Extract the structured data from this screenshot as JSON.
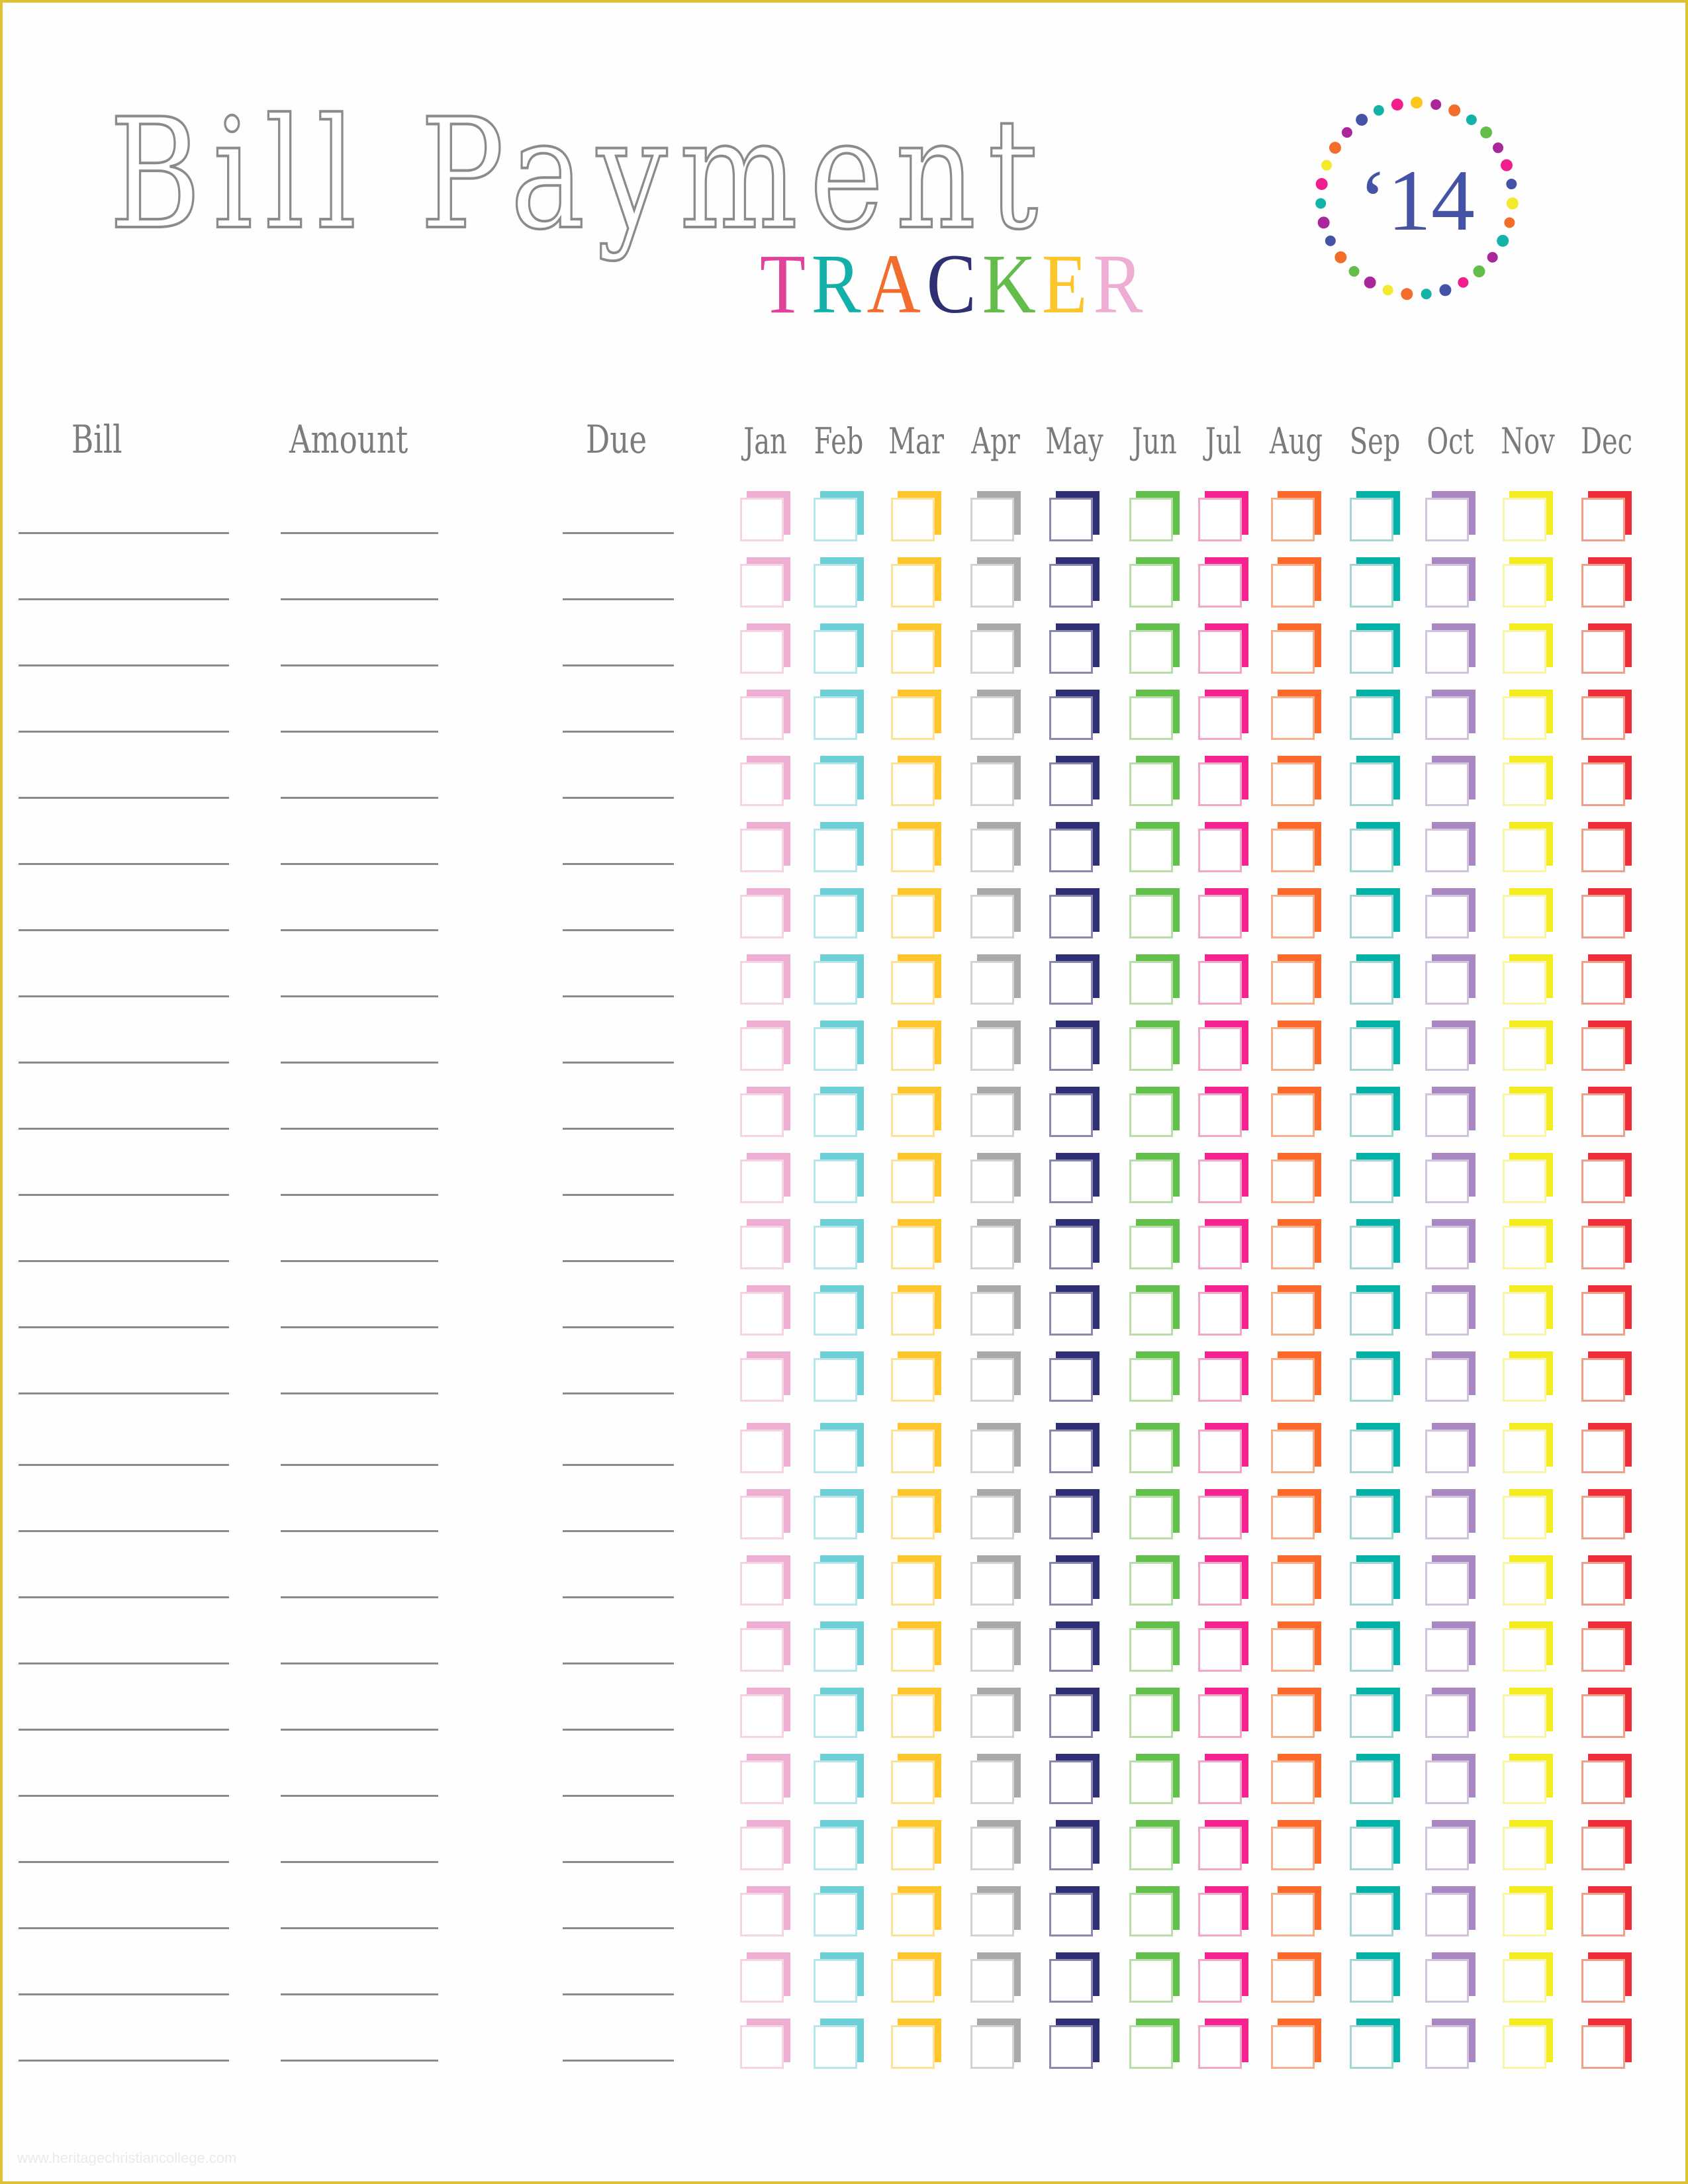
{
  "header": {
    "title_script": "Bill Payment",
    "title_tracker_letters": [
      {
        "char": "T",
        "color": "#e0439a"
      },
      {
        "char": "R",
        "color": "#13b0a9"
      },
      {
        "char": "A",
        "color": "#f26d2d"
      },
      {
        "char": "C",
        "color": "#2f2f74"
      },
      {
        "char": "K",
        "color": "#63bd4b"
      },
      {
        "char": "E",
        "color": "#fcc52c"
      },
      {
        "char": "R",
        "color": "#eeadd3"
      }
    ],
    "year_label": "‘14",
    "year_color": "#4553a6",
    "dot_colors": [
      "#fac71a",
      "#a9279a",
      "#f36c2a",
      "#14b3a8",
      "#63bd4b",
      "#a9279a",
      "#f31e8e",
      "#4553a6",
      "#f2ea2b",
      "#f36c2a",
      "#14b3a8",
      "#a9279a",
      "#63bd4b",
      "#f31e8e",
      "#4553a6",
      "#14b3a8",
      "#f36c2a",
      "#f2ea2b",
      "#a9279a",
      "#63bd4b",
      "#f36c2a",
      "#4553a6",
      "#a9279a",
      "#14b3a8",
      "#f31e8e",
      "#f2ea2b",
      "#f36c2a",
      "#a9279a",
      "#4553a6",
      "#14b3a8",
      "#f31e8e"
    ]
  },
  "columns": {
    "bill": "Bill",
    "amount": "Amount",
    "due": "Due"
  },
  "months": [
    {
      "label": "Jan",
      "color": "#eeadd3",
      "outline": "#f7d3e6"
    },
    {
      "label": "Feb",
      "color": "#6ccfd6",
      "outline": "#b8e6ea"
    },
    {
      "label": "Mar",
      "color": "#fec52c",
      "outline": "#fbe29a"
    },
    {
      "label": "Apr",
      "color": "#a8a8a8",
      "outline": "#d3d3d3"
    },
    {
      "label": "May",
      "color": "#2f2f76",
      "outline": "#8c87ad"
    },
    {
      "label": "Jun",
      "color": "#63bf4b",
      "outline": "#b7dea8"
    },
    {
      "label": "Jul",
      "color": "#f4238f",
      "outline": "#f2a6c8"
    },
    {
      "label": "Aug",
      "color": "#fb692b",
      "outline": "#f6b08c"
    },
    {
      "label": "Sep",
      "color": "#02b1a7",
      "outline": "#a3d6d3"
    },
    {
      "label": "Oct",
      "color": "#a987c3",
      "outline": "#d3c1e0"
    },
    {
      "label": "Nov",
      "color": "#f3ec21",
      "outline": "#f8f5a6"
    },
    {
      "label": "Dec",
      "color": "#ee2e39",
      "outline": "#f19f8c"
    }
  ],
  "rows": 24,
  "watermark": "www.heritagechristiancollege.com"
}
